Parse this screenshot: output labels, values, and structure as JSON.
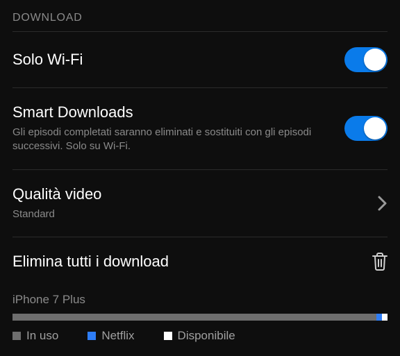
{
  "header": "DOWNLOAD",
  "rows": {
    "wifi": {
      "title": "Solo Wi-Fi"
    },
    "smart": {
      "title": "Smart Downloads",
      "desc": "Gli episodi completati saranno eliminati e sostituiti con gli episodi successivi. Solo su Wi-Fi."
    },
    "quality": {
      "title": "Qualità video",
      "value": "Standard"
    },
    "delete": {
      "title": "Elimina tutti i download"
    }
  },
  "storage": {
    "device": "iPhone 7 Plus",
    "legend": {
      "used": {
        "label": "In uso",
        "color": "#6e6e6e"
      },
      "netflix": {
        "label": "Netflix",
        "color": "#2e7df6"
      },
      "available": {
        "label": "Disponibile",
        "color": "#ffffff"
      }
    },
    "segments": [
      {
        "color": "#6e6e6e",
        "pct": 97
      },
      {
        "color": "#2e7df6",
        "pct": 1.5
      },
      {
        "color": "#ffffff",
        "pct": 1.5
      }
    ]
  },
  "colors": {
    "accent": "#0a7bea"
  }
}
